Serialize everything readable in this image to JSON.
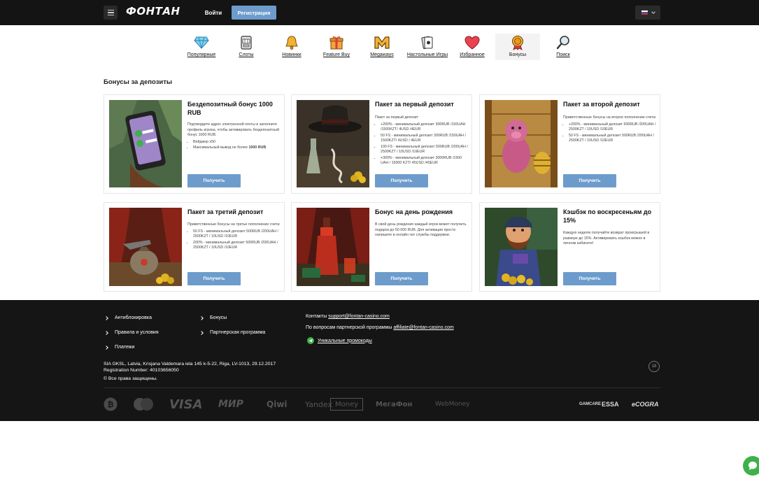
{
  "header": {
    "logo": "ФОНТАН",
    "login": "Войти",
    "register": "Регистрация"
  },
  "categories": [
    {
      "label": "Популярные",
      "icon": "diamond-icon"
    },
    {
      "label": "Слоты",
      "icon": "slot-machine-icon"
    },
    {
      "label": "Новинки",
      "icon": "bell-icon"
    },
    {
      "label": "Feature Buy",
      "icon": "gift-icon"
    },
    {
      "label": "Megaways",
      "icon": "megaways-icon"
    },
    {
      "label": "Настольные Игры",
      "icon": "cards-icon"
    },
    {
      "label": "Избранное",
      "icon": "heart-icon"
    },
    {
      "label": "Бонусы",
      "icon": "bonus-medal-icon"
    },
    {
      "label": "Поиск",
      "icon": "search-icon"
    }
  ],
  "section_title": "Бонусы за депозиты",
  "cards": [
    {
      "title": "Бездепозитный бонус 1000 RUB",
      "intro": "Подтвердите адрес электронной почты и заполните профиль игрока, чтобы активировать бездепозитный бонус 1000 RUB.",
      "items": [
        "Вейджер x50",
        "Максимальный вывод не более "
      ],
      "bold_tail": "1000 RUB",
      "button": "Получить"
    },
    {
      "title": "Пакет за первый депозит",
      "intro": "Пакет за первый депозит",
      "items": [
        "+200% - минимальный депозит 300RUB /150UAH /1500KZT/ 4USD /4EUR",
        "50 FS - минимальный депозит 300RUB /150UAH / 1500KZT/ 4USD / 4EUR",
        "100 FS - минимальный депозит 500RUB /200UAH / 2500KZT / 10USD /10EUR",
        "+300% - минимальный депозит 3000RUB /1500 UAH / 15000 KZT/ 45USD /45EUR"
      ],
      "button": "Получить"
    },
    {
      "title": "Пакет за второй депозит",
      "intro": "Приветственные бонусы на второе пополнение счета:",
      "items": [
        "+200% - минимальный депозит 500RUB /200UAH / 2500KZT / 10USD /10EUR",
        "50 FS - минимальный депозит 500RUB /200UAH / 2500KZT / 10USD /10EUR"
      ],
      "button": "Получить"
    },
    {
      "title": "Пакет за третий депозит",
      "intro": "Приветственные бонусы на третье пополнение счета:",
      "items": [
        "50 FS - минимальный депозит 500RUB /200UAH / 2500KZT / 10USD /10EUR",
        "200% - минимальный депозит 500RUB /200UAH / 2500KZT / 10USD /10EUR"
      ],
      "button": "Получить"
    },
    {
      "title": "Бонус на день рождения",
      "intro": "В свой день рождения каждый игрок может получить подарок до 50 000 RUB. Для активации просто напишите в онлайн чат службы поддержки.",
      "items": [],
      "button": "Получить"
    },
    {
      "title": "Кэшбэк по воскресеньям до 15%",
      "intro": "Каждую неделю получайте возврат проигрышей в размере до 15%. Активировать кэшбэк можно в личном кабинете!",
      "items": [],
      "button": "Получить"
    }
  ],
  "footer": {
    "links_col1": [
      "Антиблокировка",
      "Правила и условия",
      "Платежи"
    ],
    "links_col2": [
      "Бонусы",
      "Партнерская программа"
    ],
    "contacts_label": "Контакты",
    "contacts_email": "support@fontan-casino.com",
    "partner_label": "По вопросам партнерской программы",
    "partner_email": "affiliate@fontan-casino.com",
    "promo_link": "Уникальные промокоды",
    "legal_line1": "SIA GKSL, Latvia, Krisjana Valdemara iela 145 k-5-22, Riga, LV-1013, 29.12.2017",
    "legal_line2": "Registration Number: 40103656050",
    "rights": "© Все права защищены.",
    "age": "18",
    "payments": [
      "VISA",
      "МИР",
      "Qiwi",
      "Yandex",
      "Money",
      "МегаФон",
      "WebMoney"
    ],
    "certs": [
      "GAMCARE",
      "ESSA",
      "eCOGRA"
    ]
  },
  "colors": {
    "accent": "#6d9ccc",
    "header_bg": "#141414",
    "footer_bg": "#151515",
    "chat": "#3db14a"
  }
}
